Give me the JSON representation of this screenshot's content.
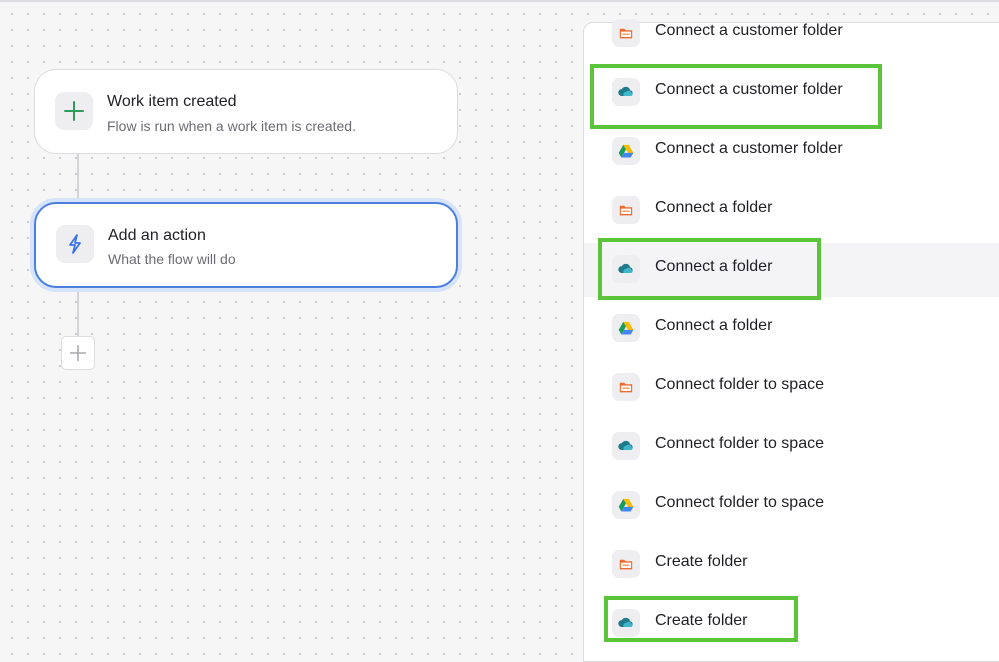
{
  "trigger": {
    "title": "Work item created",
    "subtitle": "Flow is run when a work item is created."
  },
  "action": {
    "title": "Add an action",
    "subtitle": "What the flow will do"
  },
  "options": [
    {
      "label": "Connect a customer folder",
      "icon": "box-folder-icon"
    },
    {
      "label": "Connect a customer folder",
      "icon": "onedrive-icon"
    },
    {
      "label": "Connect a customer folder",
      "icon": "google-drive-icon"
    },
    {
      "label": "Connect a folder",
      "icon": "box-folder-icon"
    },
    {
      "label": "Connect a folder",
      "icon": "onedrive-icon"
    },
    {
      "label": "Connect a folder",
      "icon": "google-drive-icon"
    },
    {
      "label": "Connect folder to space",
      "icon": "box-folder-icon"
    },
    {
      "label": "Connect folder to space",
      "icon": "onedrive-icon"
    },
    {
      "label": "Connect folder to space",
      "icon": "google-drive-icon"
    },
    {
      "label": "Create folder",
      "icon": "box-folder-icon"
    },
    {
      "label": "Create folder",
      "icon": "onedrive-icon"
    }
  ],
  "colors": {
    "highlight": "#5bc43a",
    "selected_border": "#4a7fe0",
    "trigger_icon": "#2e9b5b",
    "action_icon": "#3b74e6"
  }
}
